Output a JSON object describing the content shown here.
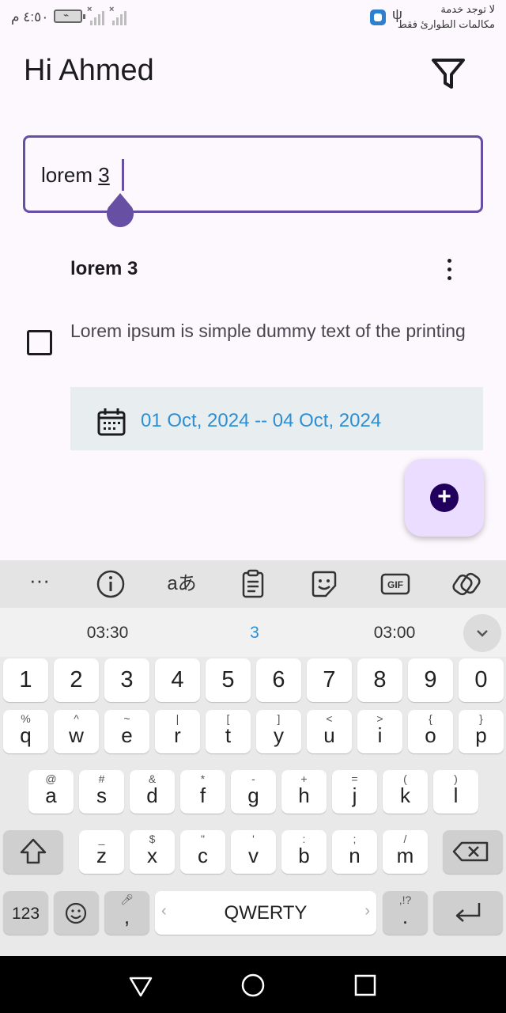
{
  "status_bar": {
    "time": "٤:٥٠ م",
    "carrier_line1": "لا توجد خدمة",
    "carrier_line2": "مكالمات الطوارئ فقط"
  },
  "header": {
    "greeting": "Hi Ahmed",
    "filter_icon": "filter-icon"
  },
  "search": {
    "text_before": "lorem ",
    "text_last": "3"
  },
  "task": {
    "title": "lorem 3",
    "description": "Lorem ipsum is simple dummy text of the printing",
    "date_range": "01 Oct, 2024 -- 04 Oct, 2024",
    "checked": false
  },
  "fab": {
    "label": "+"
  },
  "keyboard": {
    "toolbar": [
      "more-icon",
      "info-icon",
      "translate-icon",
      "clipboard-icon",
      "sticker-icon",
      "gif-icon",
      "handwriting-icon"
    ],
    "translate_glyph": "aあ",
    "gif_label": "GIF",
    "suggestions": [
      "03:30",
      "3",
      "03:00"
    ],
    "numbers": [
      "1",
      "2",
      "3",
      "4",
      "5",
      "6",
      "7",
      "8",
      "9",
      "0"
    ],
    "row1": [
      {
        "k": "q",
        "h": "%"
      },
      {
        "k": "w",
        "h": "^"
      },
      {
        "k": "e",
        "h": "~"
      },
      {
        "k": "r",
        "h": "|"
      },
      {
        "k": "t",
        "h": "["
      },
      {
        "k": "y",
        "h": "]"
      },
      {
        "k": "u",
        "h": "<"
      },
      {
        "k": "i",
        "h": ">"
      },
      {
        "k": "o",
        "h": "{"
      },
      {
        "k": "p",
        "h": "}"
      }
    ],
    "row2": [
      {
        "k": "a",
        "h": "@"
      },
      {
        "k": "s",
        "h": "#"
      },
      {
        "k": "d",
        "h": "&"
      },
      {
        "k": "f",
        "h": "*"
      },
      {
        "k": "g",
        "h": "-"
      },
      {
        "k": "h",
        "h": "+"
      },
      {
        "k": "j",
        "h": "="
      },
      {
        "k": "k",
        "h": "("
      },
      {
        "k": "l",
        "h": ")"
      }
    ],
    "row3": [
      {
        "k": "z",
        "h": "_"
      },
      {
        "k": "x",
        "h": "$"
      },
      {
        "k": "c",
        "h": "\""
      },
      {
        "k": "v",
        "h": "'"
      },
      {
        "k": "b",
        "h": ":"
      },
      {
        "k": "n",
        "h": ";"
      },
      {
        "k": "m",
        "h": "/"
      }
    ],
    "symbols_key": "123",
    "comma_key": ",",
    "space_key": "QWERTY",
    "period_key": ".",
    "period_hint": ",!?"
  }
}
